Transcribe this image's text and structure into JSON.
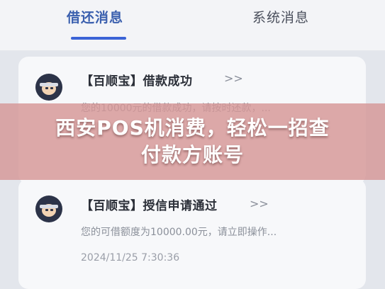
{
  "tabs": {
    "debt_label": "借还消息",
    "system_label": "系统消息"
  },
  "messages": [
    {
      "title": "【百顺宝】借款成功",
      "chevron": ">>",
      "body": "您的10000元的借款成功，请按时还款，..."
    },
    {
      "title": "【百顺宝】授信申请通过",
      "chevron": ">>",
      "body": "您的可借额度为10000.00元，请立即操作...",
      "time": "2024/11/25 7:30:36"
    }
  ],
  "banner": {
    "line1": "西安POS机消费，轻松一招查",
    "line2": "付款方账号"
  },
  "colors": {
    "accent": "#3b63d6",
    "banner_bg": "#d69696"
  }
}
